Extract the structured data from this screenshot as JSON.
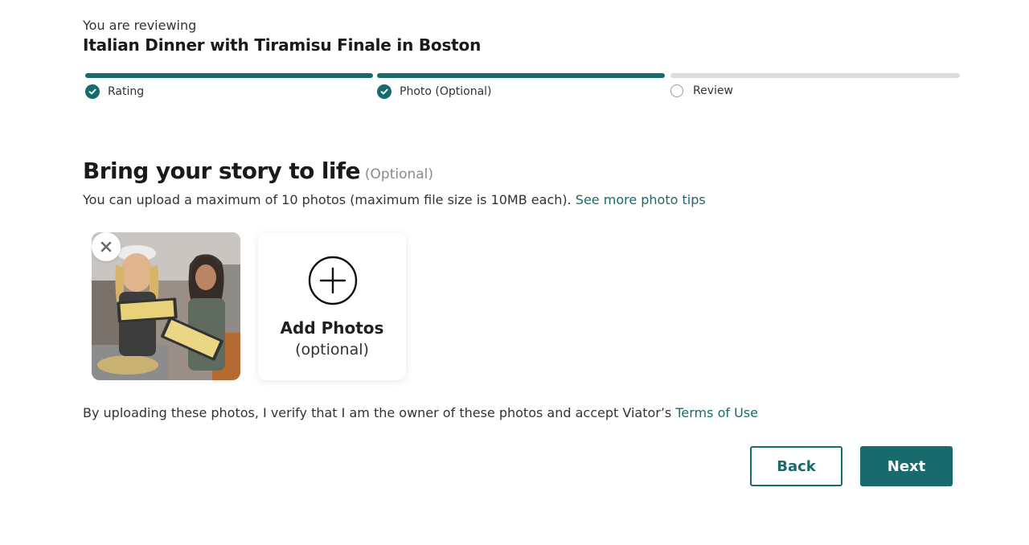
{
  "header": {
    "reviewing_label": "You are reviewing",
    "product_title": "Italian Dinner with Tiramisu Finale in Boston"
  },
  "steps": [
    {
      "label": "Rating",
      "status": "complete",
      "icon": "check-circle-icon"
    },
    {
      "label": "Photo (Optional)",
      "status": "complete",
      "icon": "check-circle-icon"
    },
    {
      "label": "Review",
      "status": "incomplete",
      "icon": "empty-circle-icon"
    }
  ],
  "section": {
    "heading": "Bring your story to life",
    "optional_tag": "(Optional)",
    "upload_info": "You can upload a maximum of 10 photos (maximum file size is 10MB each).",
    "tips_link": "See more photo tips"
  },
  "photos": {
    "uploaded_count": 1,
    "remove_icon": "close-icon",
    "add_title": "Add Photos",
    "add_subtitle": "(optional)",
    "add_icon": "plus-circle-icon"
  },
  "consent": {
    "text": "By uploading these photos, I verify that I am the owner of these photos and accept Viator’s",
    "terms_link": "Terms of Use"
  },
  "actions": {
    "back_label": "Back",
    "next_label": "Next"
  },
  "colors": {
    "accent": "#186b6d",
    "inactive_bar": "#dcdcdc",
    "muted_text": "#8a8a8a"
  }
}
